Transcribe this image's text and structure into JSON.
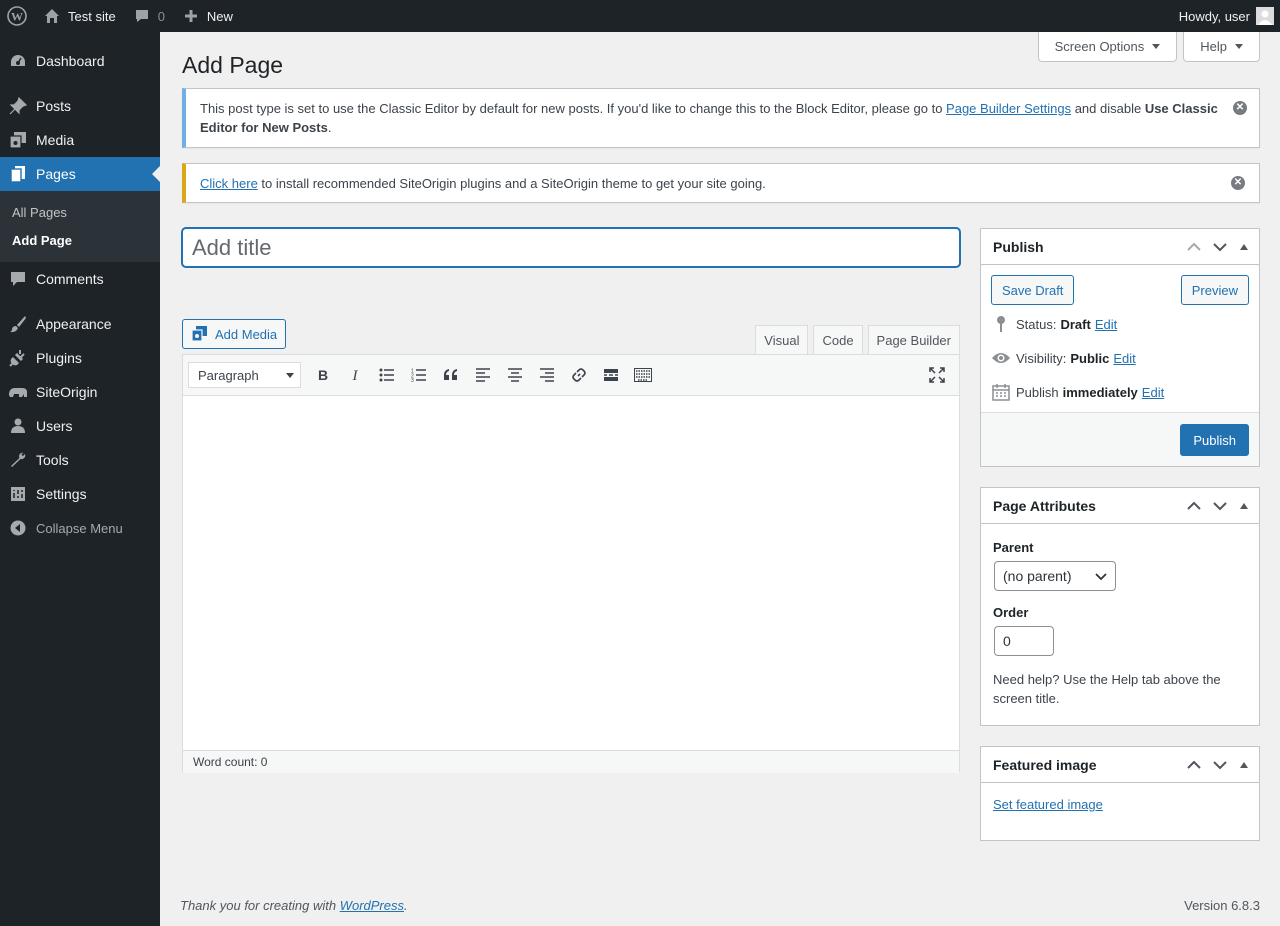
{
  "adminbar": {
    "site_name": "Test site",
    "comments_count": "0",
    "new_label": "New",
    "howdy": "Howdy, user"
  },
  "sidebar": {
    "items": [
      {
        "label": "Dashboard",
        "icon": "dashboard-icon"
      },
      {
        "label": "Posts",
        "icon": "pin-icon"
      },
      {
        "label": "Media",
        "icon": "media-icon"
      },
      {
        "label": "Pages",
        "icon": "pages-icon"
      },
      {
        "label": "Comments",
        "icon": "comment-icon"
      },
      {
        "label": "Appearance",
        "icon": "brush-icon"
      },
      {
        "label": "Plugins",
        "icon": "plugin-icon"
      },
      {
        "label": "SiteOrigin",
        "icon": "siteorigin-icon"
      },
      {
        "label": "Users",
        "icon": "user-icon"
      },
      {
        "label": "Tools",
        "icon": "wrench-icon"
      },
      {
        "label": "Settings",
        "icon": "settings-icon"
      }
    ],
    "submenu": [
      "All Pages",
      "Add Page"
    ],
    "collapse_label": "Collapse Menu"
  },
  "screen_meta": {
    "screen_options": "Screen Options",
    "help": "Help"
  },
  "page_title": "Add Page",
  "notices": {
    "classic": {
      "text_before": "This post type is set to use the Classic Editor by default for new posts. If you'd like to change this to the Block Editor, please go to ",
      "link": "Page Builder Settings",
      "text_middle": " and disable ",
      "bold": "Use Classic Editor for New Posts",
      "text_after": "."
    },
    "siteorigin": {
      "link": "Click here",
      "text": " to install recommended SiteOrigin plugins and a SiteOrigin theme to get your site going."
    }
  },
  "title_field": {
    "placeholder": "Add title",
    "value": ""
  },
  "editor": {
    "add_media": "Add Media",
    "tabs": [
      "Visual",
      "Code",
      "Page Builder"
    ],
    "active_tab": "Visual",
    "format": "Paragraph",
    "word_count": "Word count: 0"
  },
  "publish": {
    "title": "Publish",
    "save_draft": "Save Draft",
    "preview": "Preview",
    "status_label": "Status:",
    "status_value": "Draft",
    "visibility_label": "Visibility:",
    "visibility_value": "Public",
    "schedule_label": "Publish",
    "schedule_value": "immediately",
    "edit": "Edit",
    "publish_button": "Publish"
  },
  "attributes": {
    "title": "Page Attributes",
    "parent_label": "Parent",
    "parent_value": "(no parent)",
    "order_label": "Order",
    "order_value": "0",
    "help": "Need help? Use the Help tab above the screen title."
  },
  "featured": {
    "title": "Featured image",
    "link": "Set featured image"
  },
  "footer": {
    "thanks_before": "Thank you for creating with ",
    "wordpress": "WordPress",
    "thanks_after": ".",
    "version": "Version 6.8.3"
  }
}
